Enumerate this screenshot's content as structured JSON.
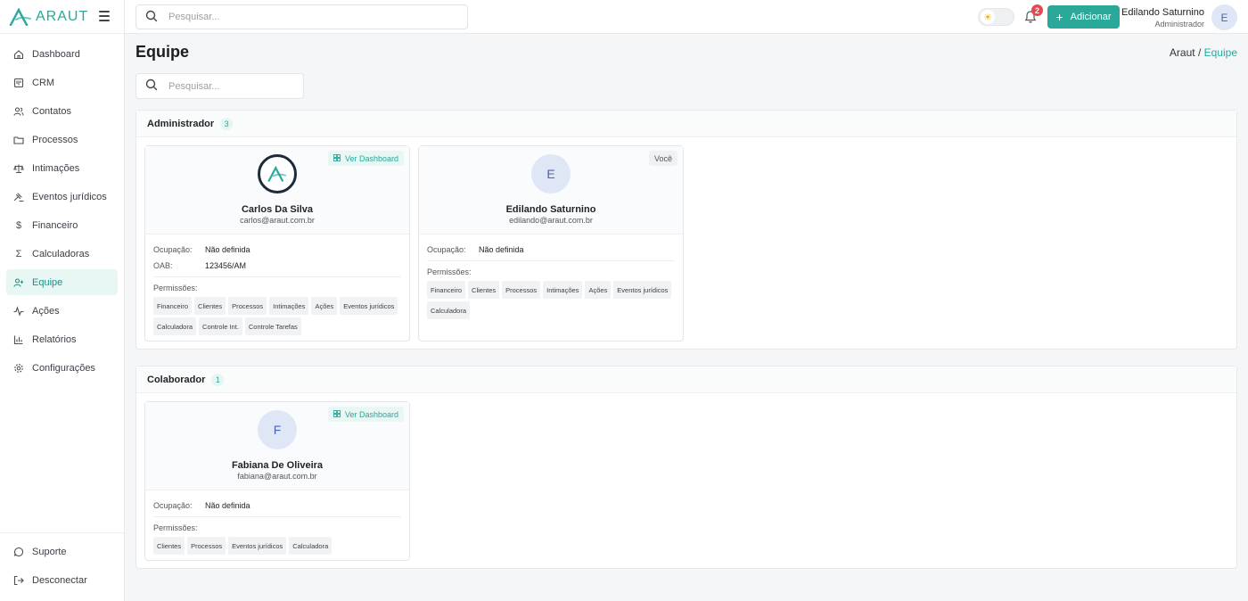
{
  "brand": {
    "name": "ARAUT"
  },
  "search_top": {
    "placeholder": "Pesquisar..."
  },
  "header": {
    "notifications_count": "2",
    "add_label": "Adicionar",
    "user_name": "Edilando Saturnino",
    "user_role": "Administrador",
    "user_initial": "E"
  },
  "sidebar": {
    "items": [
      {
        "label": "Dashboard",
        "icon": "home-icon"
      },
      {
        "label": "CRM",
        "icon": "kanban-icon"
      },
      {
        "label": "Contatos",
        "icon": "users-icon"
      },
      {
        "label": "Processos",
        "icon": "folder-icon"
      },
      {
        "label": "Intimações",
        "icon": "scale-icon"
      },
      {
        "label": "Eventos jurídicos",
        "icon": "gavel-icon"
      },
      {
        "label": "Financeiro",
        "icon": "dollar-icon"
      },
      {
        "label": "Calculadoras",
        "icon": "sigma-icon"
      },
      {
        "label": "Equipe",
        "icon": "user-plus-icon",
        "active": true
      },
      {
        "label": "Ações",
        "icon": "activity-icon"
      },
      {
        "label": "Relatórios",
        "icon": "bar-chart-icon"
      },
      {
        "label": "Configurações",
        "icon": "gear-icon"
      }
    ],
    "bottom": [
      {
        "label": "Suporte",
        "icon": "chat-icon"
      },
      {
        "label": "Desconectar",
        "icon": "logout-icon"
      }
    ]
  },
  "page": {
    "title": "Equipe",
    "breadcrumb_root": "Araut /",
    "breadcrumb_current": "Equipe",
    "search_placeholder": "Pesquisar..."
  },
  "labels": {
    "ocupacao": "Ocupação:",
    "oab": "OAB:",
    "permissoes": "Permissões:",
    "ver_dashboard": "Ver Dashboard",
    "voce": "Você"
  },
  "groups": [
    {
      "title": "Administrador",
      "count": "3",
      "members": [
        {
          "name": "Carlos Da Silva",
          "email": "carlos@araut.com.br",
          "ocupacao": "Não definida",
          "oab": "123456/AM",
          "permissions": [
            "Financeiro",
            "Clientes",
            "Processos",
            "Intimações",
            "Ações",
            "Eventos jurídicos",
            "Calculadora",
            "Controle Int.",
            "Controle Tarefas"
          ]
        },
        {
          "name": "Edilando Saturnino",
          "initial": "E",
          "email": "edilando@araut.com.br",
          "ocupacao": "Não definida",
          "permissions": [
            "Financeiro",
            "Clientes",
            "Processos",
            "Intimações",
            "Ações",
            "Eventos jurídicos",
            "Calculadora"
          ]
        }
      ]
    },
    {
      "title": "Colaborador",
      "count": "1",
      "members": [
        {
          "name": "Fabiana De Oliveira",
          "initial": "F",
          "email": "fabiana@araut.com.br",
          "ocupacao": "Não definida",
          "permissions": [
            "Clientes",
            "Processos",
            "Eventos jurídicos",
            "Calculadora"
          ]
        }
      ]
    }
  ],
  "colors": {
    "accent": "#2aa89a",
    "badge_red": "#e5484d",
    "avatar_bg": "#dfe7f7"
  }
}
